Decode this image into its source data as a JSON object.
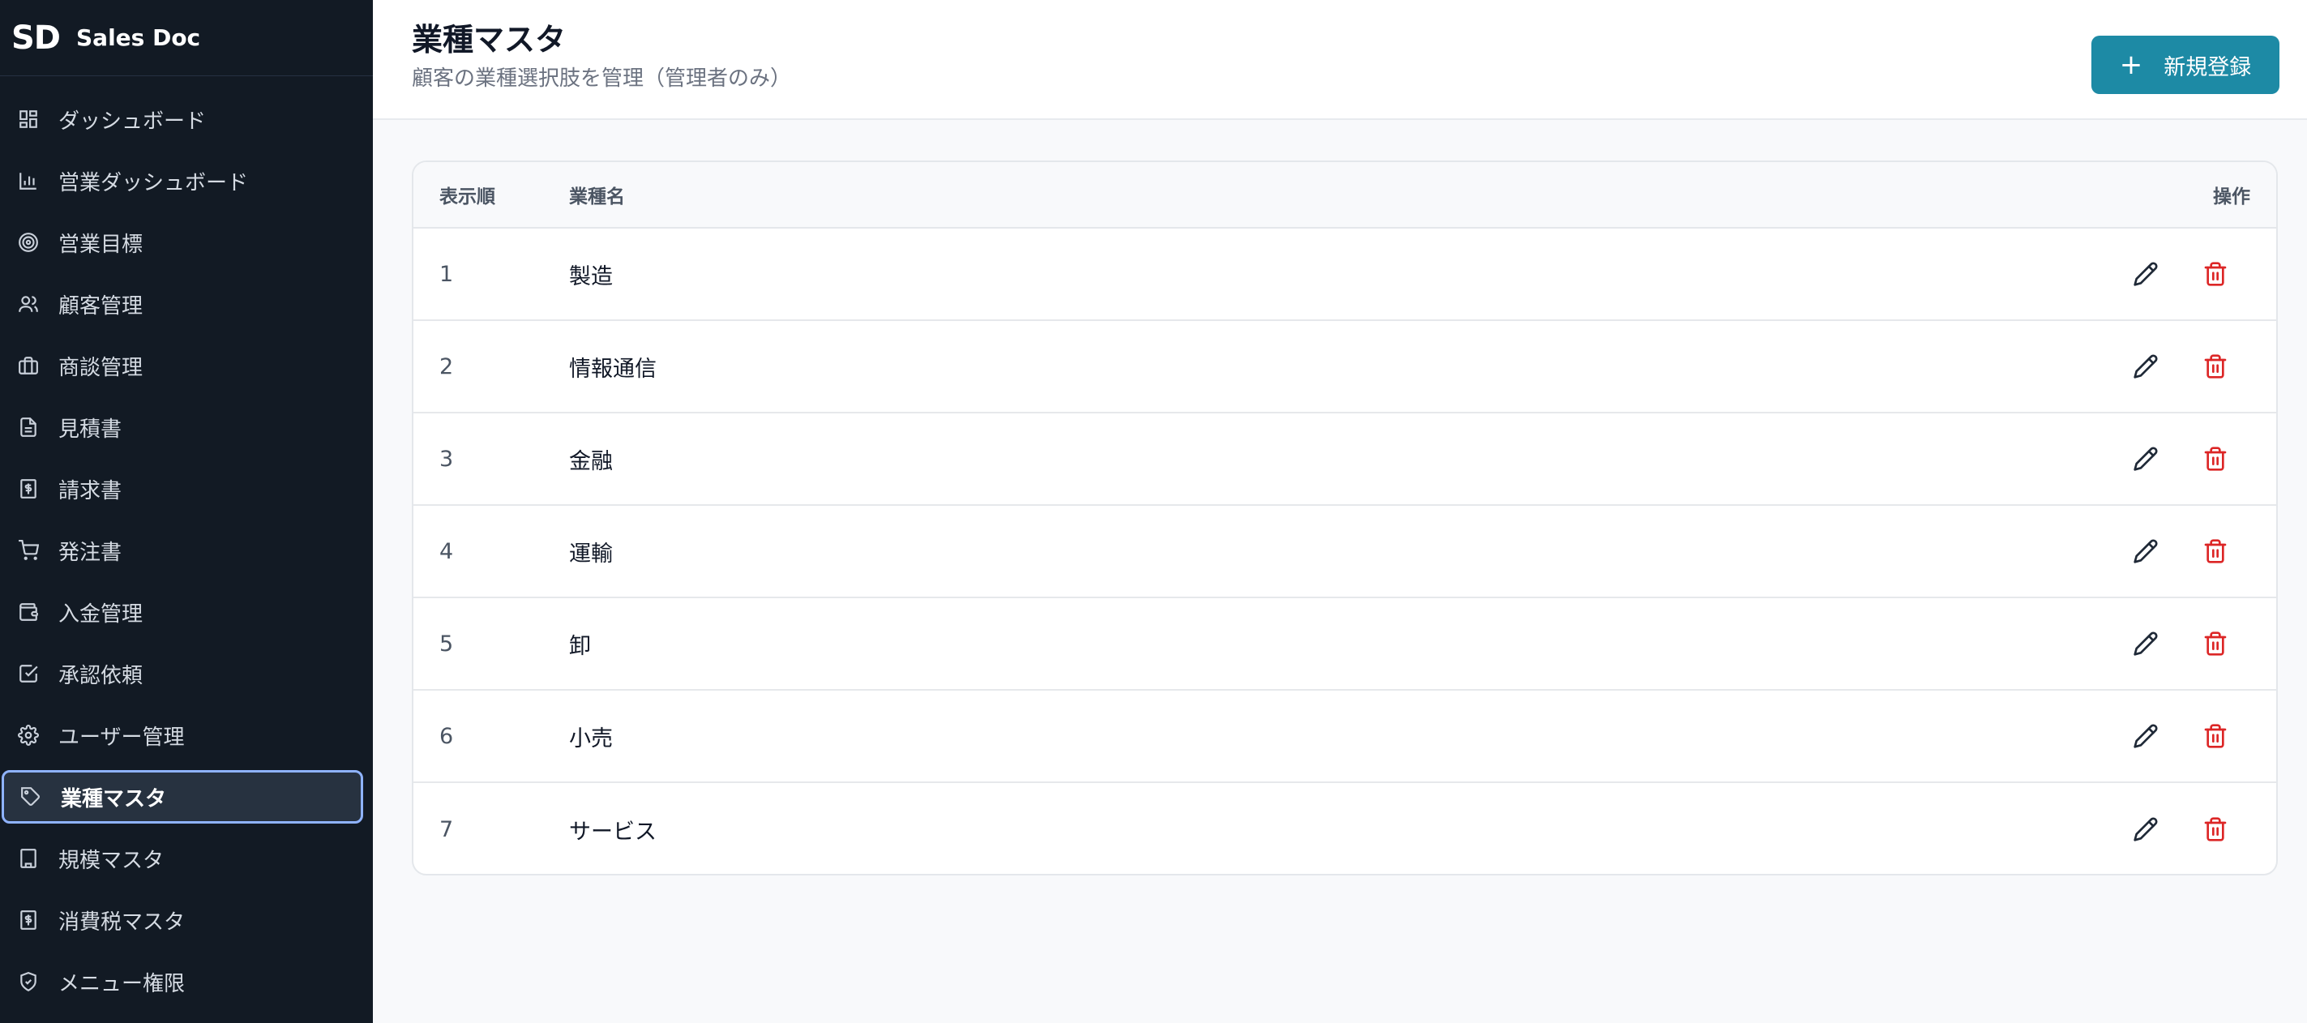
{
  "brand": {
    "logo": "SD",
    "name": "Sales Doc"
  },
  "sidebar": {
    "items": [
      {
        "label": "ダッシュボード",
        "icon": "grid-icon"
      },
      {
        "label": "営業ダッシュボード",
        "icon": "bar-chart-icon"
      },
      {
        "label": "営業目標",
        "icon": "target-icon"
      },
      {
        "label": "顧客管理",
        "icon": "users-icon"
      },
      {
        "label": "商談管理",
        "icon": "briefcase-icon"
      },
      {
        "label": "見積書",
        "icon": "file-text-icon"
      },
      {
        "label": "請求書",
        "icon": "receipt-icon"
      },
      {
        "label": "発注書",
        "icon": "cart-icon"
      },
      {
        "label": "入金管理",
        "icon": "wallet-icon"
      },
      {
        "label": "承認依頼",
        "icon": "check-square-icon"
      },
      {
        "label": "ユーザー管理",
        "icon": "gear-icon"
      },
      {
        "label": "業種マスタ",
        "icon": "tag-icon",
        "active": true
      },
      {
        "label": "規模マスタ",
        "icon": "building-icon"
      },
      {
        "label": "消費税マスタ",
        "icon": "receipt-icon"
      },
      {
        "label": "メニュー権限",
        "icon": "shield-icon"
      }
    ]
  },
  "header": {
    "title": "業種マスタ",
    "subtitle": "顧客の業種選択肢を管理（管理者のみ）",
    "new_button": "新規登録"
  },
  "table": {
    "columns": {
      "order": "表示順",
      "name": "業種名",
      "ops": "操作"
    },
    "rows": [
      {
        "order": "1",
        "name": "製造"
      },
      {
        "order": "2",
        "name": "情報通信"
      },
      {
        "order": "3",
        "name": "金融"
      },
      {
        "order": "4",
        "name": "運輸"
      },
      {
        "order": "5",
        "name": "卸"
      },
      {
        "order": "6",
        "name": "小売"
      },
      {
        "order": "7",
        "name": "サービス"
      }
    ]
  },
  "colors": {
    "sidebar_bg": "#121a24",
    "accent": "#1d8aa5",
    "delete": "#dc2626",
    "active_border": "#8fb3ff"
  }
}
